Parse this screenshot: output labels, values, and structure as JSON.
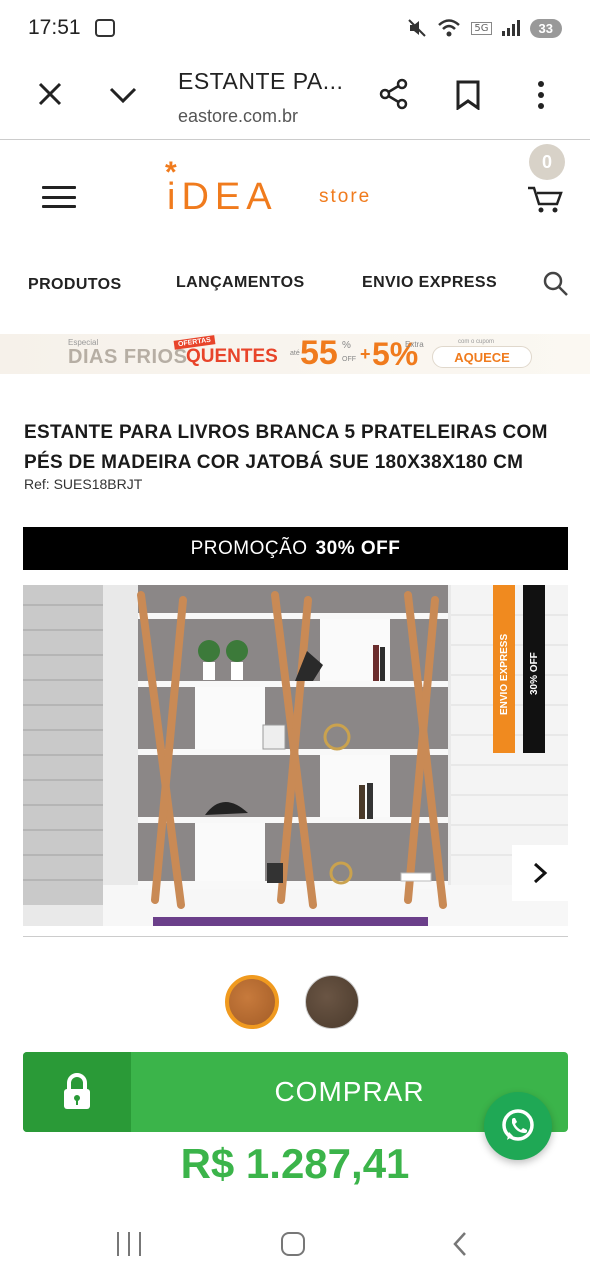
{
  "status_bar": {
    "time": "17:51",
    "network": "5G",
    "battery": "33"
  },
  "browser": {
    "title": "ESTANTE PA...",
    "url": "eastore.com.br"
  },
  "site": {
    "logo_mark": "*",
    "logo_word": "iDEA",
    "logo_suffix": "store",
    "cart_count": "0",
    "brand_color": "#f07b1d"
  },
  "nav": {
    "items": [
      "PRODUTOS",
      "LANÇAMENTOS",
      "ENVIO EXPRESS"
    ]
  },
  "banner": {
    "small_label": "Especial",
    "dias_frios": "DIAS FRIOS",
    "ofertas": "OFERTAS",
    "quentes": "QUENTES",
    "ate": "até",
    "big_value": "55",
    "pct": "%",
    "off": "OFF",
    "plus": "+",
    "extra_value": "5%",
    "extra": "Extra",
    "coupon_label": "com o cupom",
    "coupon": "AQUECE"
  },
  "product": {
    "title_line1": "ESTANTE PARA LIVROS BRANCA 5 PRATELEIRAS COM",
    "title_line2": "PÉS DE MADEIRA COR JATOBÁ SUE 180X38X180 CM",
    "ref": "Ref: SUES18BRJT",
    "promo_prefix": "PROMOÇÃO",
    "promo_value": "30% OFF",
    "image_tag_express": "ENVIO EXPRESS",
    "image_tag_off": "30% OFF",
    "buy_label": "COMPRAR",
    "price": "R$ 1.287,41",
    "swatch_colors": [
      "#b56a30",
      "#5a4636"
    ],
    "accent_green": "#3bb44a"
  }
}
